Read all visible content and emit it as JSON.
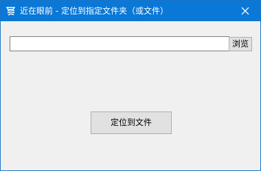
{
  "window": {
    "title": "近在眼前 - 定位到指定文件夹（或文件）",
    "app_icon": "app-logo-icon",
    "close_icon": "close-icon"
  },
  "form": {
    "path_value": "",
    "browse_label": "浏览",
    "locate_label": "定位到文件"
  },
  "colors": {
    "titlebar": "#0a78d7",
    "window_bg": "#f0f0f0",
    "button_bg": "#e1e1e1"
  }
}
